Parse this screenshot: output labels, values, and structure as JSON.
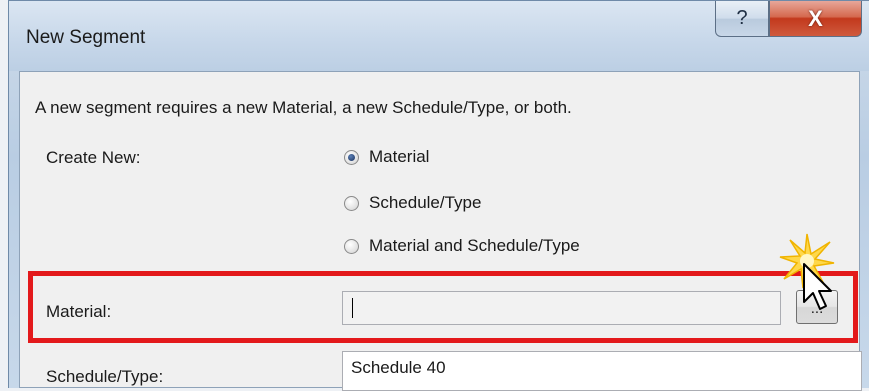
{
  "window": {
    "title": "New Segment",
    "help_label": "?",
    "close_label": "X"
  },
  "dialog": {
    "description": "A new segment requires a new Material, a new Schedule/Type, or both.",
    "create_new_label": "Create New:",
    "options": [
      {
        "label": "Material",
        "checked": true
      },
      {
        "label": "Schedule/Type",
        "checked": false
      },
      {
        "label": "Material and Schedule/Type",
        "checked": false
      }
    ],
    "material_label": "Material:",
    "material_value": "",
    "browse_label": "...",
    "schedule_label": "Schedule/Type:",
    "schedule_value": "Schedule 40"
  },
  "colors": {
    "highlight": "#e3191b",
    "close_button": "#c3391d"
  },
  "icons": {
    "help": "question-mark",
    "close": "x-mark",
    "cursor": "arrow-pointer",
    "click_burst": "sparkle"
  }
}
